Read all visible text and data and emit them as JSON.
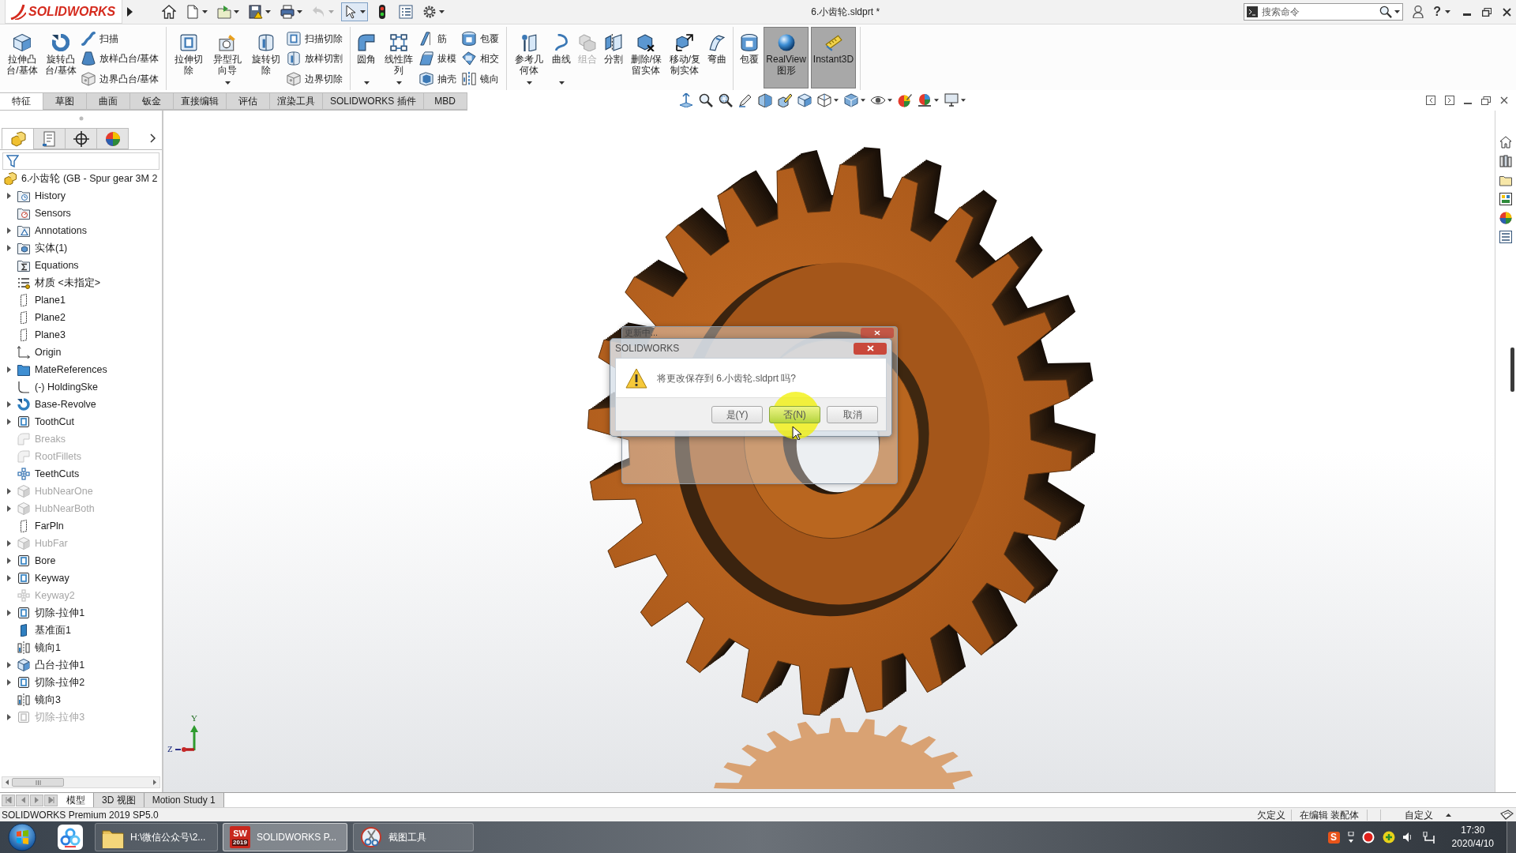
{
  "title_bar": {
    "logo": "SOLIDWORKS",
    "quick_access": [
      {
        "dropdown": false,
        "disabled": false,
        "pressed": false
      },
      {
        "dropdown": true,
        "disabled": false,
        "pressed": false
      },
      {
        "dropdown": true,
        "disabled": false,
        "pressed": false
      },
      {
        "dropdown": true,
        "disabled": false,
        "pressed": false
      },
      {
        "dropdown": true,
        "disabled": false,
        "pressed": false
      },
      {
        "dropdown": true,
        "disabled": true,
        "pressed": false
      },
      {
        "dropdown": true,
        "disabled": false,
        "pressed": true
      },
      {
        "dropdown": false,
        "disabled": false,
        "pressed": false
      },
      {
        "dropdown": false,
        "disabled": false,
        "pressed": false
      },
      {
        "dropdown": true,
        "disabled": false,
        "pressed": false
      }
    ],
    "document_title": "6.小齿轮.sldprt *",
    "search": {
      "placeholder": "搜索命令"
    },
    "help": "?"
  },
  "ribbon": {
    "groups": [
      {
        "items": [
          {
            "kind": "large",
            "label": "拉伸凸台/基体",
            "dropdown": false,
            "disabled": false,
            "on": false
          },
          {
            "kind": "large",
            "label": "旋转凸台/基体",
            "dropdown": false,
            "disabled": false,
            "on": false
          },
          {
            "kind": "stack",
            "entries": [
              {
                "label": "扫描"
              },
              {
                "label": "放样凸台/基体"
              },
              {
                "label": "边界凸台/基体"
              }
            ]
          }
        ]
      },
      {
        "items": [
          {
            "kind": "large",
            "label": "拉伸切除",
            "dropdown": false,
            "disabled": false,
            "on": false
          },
          {
            "kind": "large",
            "label": "异型孔向导",
            "dropdown": true,
            "disabled": false,
            "on": false
          },
          {
            "kind": "large",
            "label": "旋转切除",
            "dropdown": false,
            "disabled": false,
            "on": false
          },
          {
            "kind": "stack",
            "entries": [
              {
                "label": "扫描切除"
              },
              {
                "label": "放样切割"
              },
              {
                "label": "边界切除"
              }
            ]
          }
        ]
      },
      {
        "items": [
          {
            "kind": "large",
            "label": "圆角",
            "dropdown": true,
            "disabled": false,
            "on": false
          },
          {
            "kind": "large",
            "label": "线性阵列",
            "dropdown": true,
            "disabled": false,
            "on": false
          },
          {
            "kind": "stack",
            "entries": [
              {
                "label": "筋"
              },
              {
                "label": "拔模"
              },
              {
                "label": "抽壳"
              }
            ]
          },
          {
            "kind": "stack",
            "entries": [
              {
                "label": "包覆"
              },
              {
                "label": "相交"
              },
              {
                "label": "镜向"
              }
            ]
          }
        ]
      },
      {
        "items": [
          {
            "kind": "large",
            "label": "参考几何体",
            "dropdown": true,
            "disabled": false,
            "on": false
          },
          {
            "kind": "large",
            "label": "曲线",
            "dropdown": true,
            "disabled": false,
            "on": false
          },
          {
            "kind": "large",
            "label": "组合",
            "dropdown": false,
            "disabled": true,
            "on": false
          },
          {
            "kind": "large",
            "label": "分割",
            "dropdown": false,
            "disabled": false,
            "on": false
          },
          {
            "kind": "large",
            "label": "删除/保留实体",
            "dropdown": false,
            "disabled": false,
            "on": false
          },
          {
            "kind": "large",
            "label": "移动/复制实体",
            "dropdown": false,
            "disabled": false,
            "on": false
          },
          {
            "kind": "large",
            "label": "弯曲",
            "dropdown": false,
            "disabled": false,
            "on": false
          }
        ]
      },
      {
        "items": [
          {
            "kind": "large",
            "label": "包覆",
            "dropdown": false,
            "disabled": false,
            "on": false
          },
          {
            "kind": "large",
            "label": "RealView\n图形",
            "dropdown": false,
            "disabled": false,
            "on": true
          },
          {
            "kind": "large",
            "label": "Instant3D",
            "dropdown": false,
            "disabled": false,
            "on": true
          }
        ]
      }
    ]
  },
  "command_tabs": [
    {
      "label": "特征",
      "selected": true
    },
    {
      "label": "草图",
      "selected": false
    },
    {
      "label": "曲面",
      "selected": false
    },
    {
      "label": "钣金",
      "selected": false
    },
    {
      "label": "直接编辑",
      "selected": false
    },
    {
      "label": "评估",
      "selected": false
    },
    {
      "label": "渲染工具",
      "selected": false
    },
    {
      "label": "SOLIDWORKS 插件",
      "selected": false
    },
    {
      "label": "MBD",
      "selected": false
    }
  ],
  "view_toolbar": [
    {
      "dropdown": false
    },
    {
      "dropdown": false
    },
    {
      "dropdown": false
    },
    {
      "dropdown": false
    },
    {
      "dropdown": false
    },
    {
      "dropdown": false
    },
    {
      "dropdown": false
    },
    {
      "dropdown": true
    },
    {
      "dropdown": true
    },
    {
      "dropdown": true
    },
    {
      "dropdown": false
    },
    {
      "dropdown": true
    },
    {
      "dropdown": true
    }
  ],
  "panel_tabs": [
    {
      "selected": true
    },
    {
      "selected": false
    },
    {
      "selected": false
    },
    {
      "selected": false
    }
  ],
  "feature_tree": {
    "label": "6.小齿轮 (GB - Spur gear 3M 2",
    "children": [
      {
        "label": "History",
        "expandable": true,
        "suppressed": false
      },
      {
        "label": "Sensors",
        "expandable": false,
        "suppressed": false
      },
      {
        "label": "Annotations",
        "expandable": true,
        "suppressed": false
      },
      {
        "label": "实体(1)",
        "expandable": true,
        "suppressed": false
      },
      {
        "label": "Equations",
        "expandable": false,
        "suppressed": false
      },
      {
        "label": "材质 <未指定>",
        "expandable": false,
        "suppressed": false
      },
      {
        "label": "Plane1",
        "expandable": false,
        "suppressed": false
      },
      {
        "label": "Plane2",
        "expandable": false,
        "suppressed": false
      },
      {
        "label": "Plane3",
        "expandable": false,
        "suppressed": false
      },
      {
        "label": "Origin",
        "expandable": false,
        "suppressed": false
      },
      {
        "label": "MateReferences",
        "expandable": true,
        "suppressed": false
      },
      {
        "label": "(-) HoldingSke",
        "expandable": false,
        "suppressed": false
      },
      {
        "label": "Base-Revolve",
        "expandable": true,
        "suppressed": false
      },
      {
        "label": "ToothCut",
        "expandable": true,
        "suppressed": false
      },
      {
        "label": "Breaks",
        "expandable": false,
        "suppressed": true
      },
      {
        "label": "RootFillets",
        "expandable": false,
        "suppressed": true
      },
      {
        "label": "TeethCuts",
        "expandable": false,
        "suppressed": false
      },
      {
        "label": "HubNearOne",
        "expandable": true,
        "suppressed": true
      },
      {
        "label": "HubNearBoth",
        "expandable": true,
        "suppressed": true
      },
      {
        "label": "FarPln",
        "expandable": false,
        "suppressed": false
      },
      {
        "label": "HubFar",
        "expandable": true,
        "suppressed": true
      },
      {
        "label": "Bore",
        "expandable": true,
        "suppressed": false
      },
      {
        "label": "Keyway",
        "expandable": true,
        "suppressed": false
      },
      {
        "label": "Keyway2",
        "expandable": false,
        "suppressed": true
      },
      {
        "label": "切除-拉伸1",
        "expandable": true,
        "suppressed": false
      },
      {
        "label": "基准面1",
        "expandable": false,
        "suppressed": false
      },
      {
        "label": "镜向1",
        "expandable": false,
        "suppressed": false
      },
      {
        "label": "凸台-拉伸1",
        "expandable": true,
        "suppressed": false
      },
      {
        "label": "切除-拉伸2",
        "expandable": true,
        "suppressed": false
      },
      {
        "label": "镜向3",
        "expandable": false,
        "suppressed": false
      },
      {
        "label": "切除-拉伸3",
        "expandable": true,
        "suppressed": true
      }
    ]
  },
  "viewport": {
    "triad": {
      "y_label": "Y",
      "z_label": "Z"
    }
  },
  "dialog": {
    "background_window": {
      "title": "更新中..."
    },
    "title": "SOLIDWORKS",
    "message": "将更改保存到 6.小齿轮.sldprt 吗?",
    "buttons": [
      {
        "label": "是(Y)",
        "selected": false
      },
      {
        "label": "否(N)",
        "selected": true
      },
      {
        "label": "取消",
        "selected": false
      }
    ]
  },
  "bottom_tabs": [
    {
      "label": "模型",
      "selected": true
    },
    {
      "label": "3D 视图",
      "selected": false
    },
    {
      "label": "Motion Study 1",
      "selected": false
    }
  ],
  "status_bar": {
    "product": "SOLIDWORKS Premium 2019 SP5.0",
    "definition": "欠定义",
    "editing": "在编辑 装配体",
    "units": "自定义"
  },
  "taskbar": {
    "buttons": [
      {
        "label": "H:\\微信公众号\\2...",
        "active": false
      },
      {
        "label": "SOLIDWORKS P...",
        "active": true,
        "app_logo": {
          "letters": "SW",
          "badge": "2019"
        }
      },
      {
        "label": "截图工具",
        "active": false
      }
    ],
    "ime": "S",
    "clock": {
      "time": "17:30",
      "date": "2020/4/10"
    }
  }
}
